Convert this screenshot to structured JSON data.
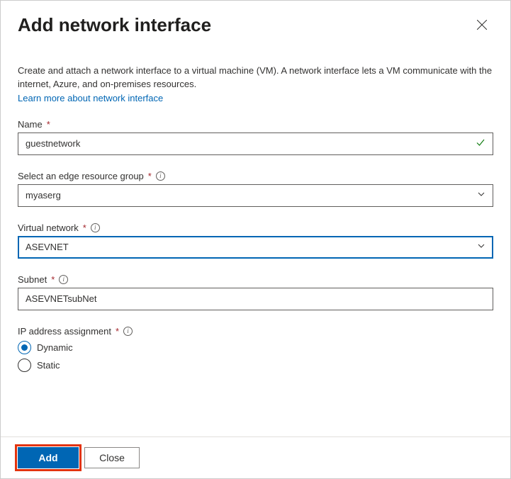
{
  "header": {
    "title": "Add network interface"
  },
  "description": "Create and attach a network interface to a virtual machine (VM). A network interface lets a VM communicate with the internet, Azure, and on-premises resources.",
  "learn_more": "Learn more about network interface",
  "fields": {
    "name": {
      "label": "Name",
      "value": "guestnetwork"
    },
    "resource_group": {
      "label": "Select an edge resource group",
      "value": "myaserg"
    },
    "virtual_network": {
      "label": "Virtual network",
      "value": "ASEVNET"
    },
    "subnet": {
      "label": "Subnet",
      "value": "ASEVNETsubNet"
    },
    "ip_assignment": {
      "label": "IP address assignment",
      "options": {
        "dynamic": "Dynamic",
        "static": "Static"
      },
      "selected": "dynamic"
    }
  },
  "buttons": {
    "add": "Add",
    "close": "Close"
  }
}
